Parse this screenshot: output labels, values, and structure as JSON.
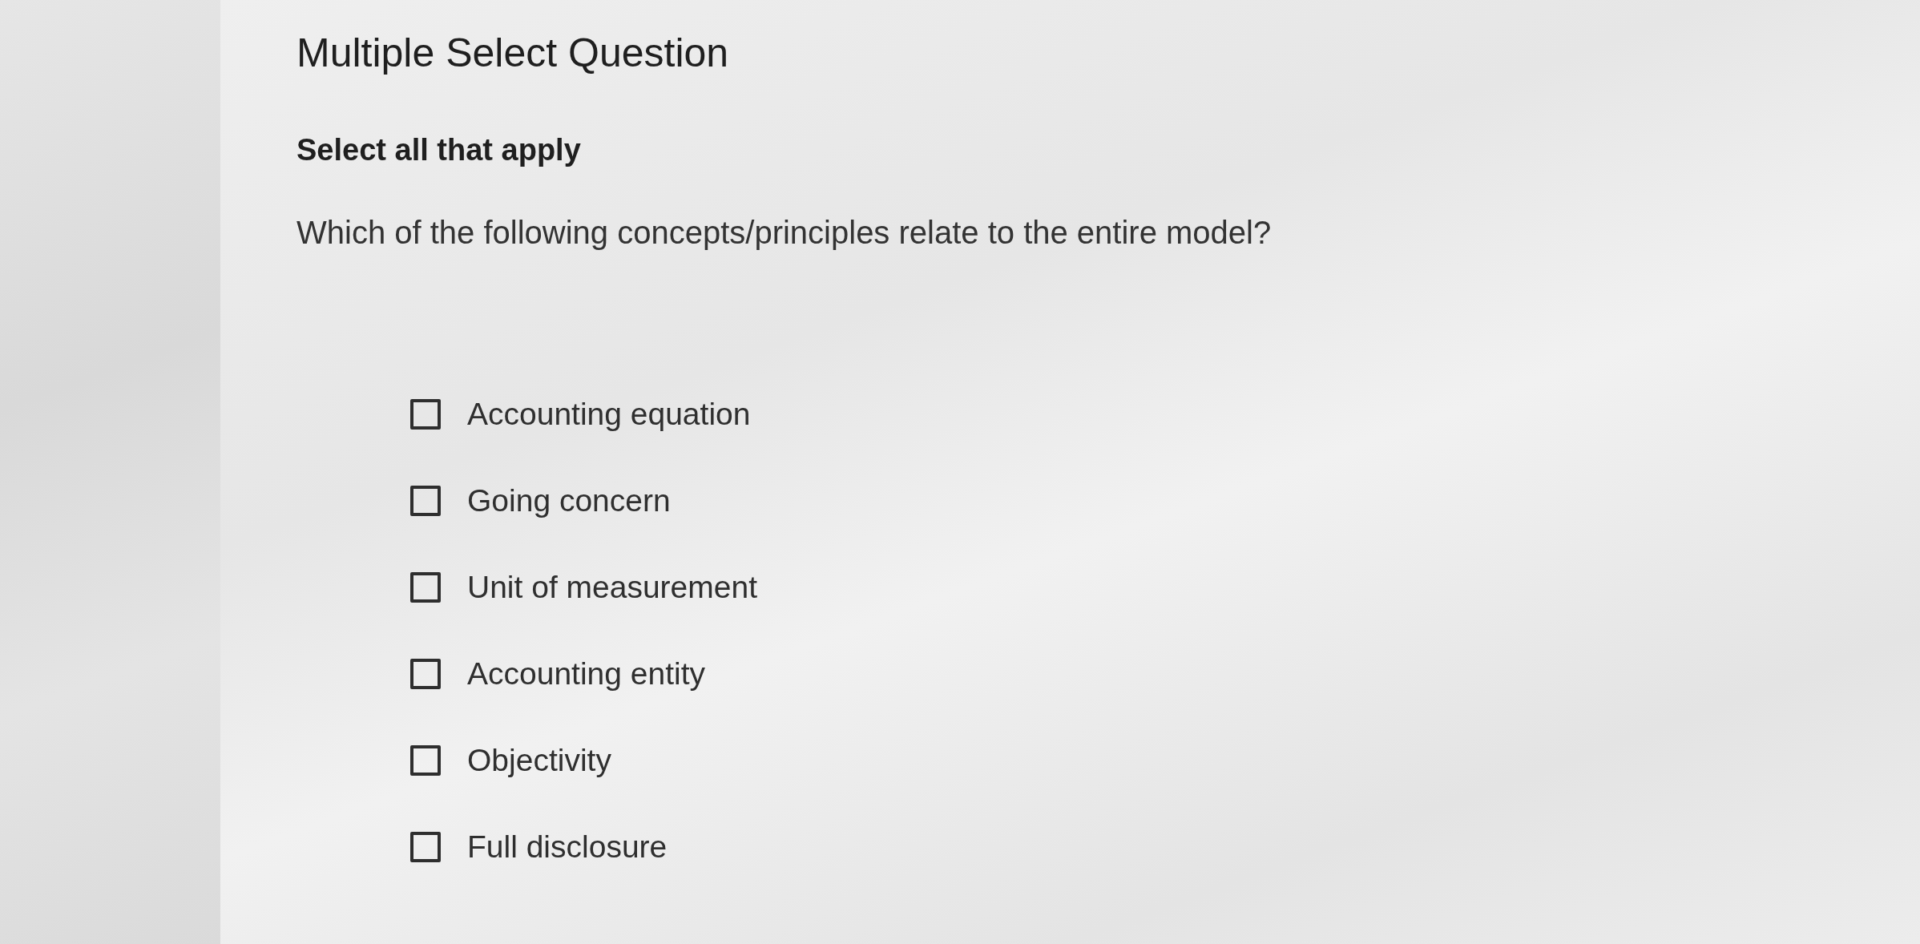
{
  "title": "Multiple Select Question",
  "instruction": "Select all that apply",
  "question": "Which of the following concepts/principles relate to the entire model?",
  "options": [
    {
      "label": "Accounting equation",
      "checked": false
    },
    {
      "label": "Going concern",
      "checked": false
    },
    {
      "label": "Unit of measurement",
      "checked": false
    },
    {
      "label": "Accounting entity",
      "checked": false
    },
    {
      "label": "Objectivity",
      "checked": false
    },
    {
      "label": "Full disclosure",
      "checked": false
    }
  ]
}
